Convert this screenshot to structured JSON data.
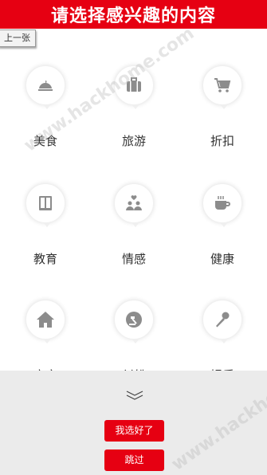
{
  "header": {
    "title": "请选择感兴趣的内容"
  },
  "prev_button": {
    "label": "上一张"
  },
  "categories": [
    {
      "label": "美食",
      "icon": "food-cloche-icon"
    },
    {
      "label": "旅游",
      "icon": "suitcase-icon"
    },
    {
      "label": "折扣",
      "icon": "shopping-cart-icon"
    },
    {
      "label": "教育",
      "icon": "book-icon"
    },
    {
      "label": "情感",
      "icon": "people-heart-icon"
    },
    {
      "label": "健康",
      "icon": "coffee-cup-icon"
    },
    {
      "label": "房产",
      "icon": "house-icon"
    },
    {
      "label": "纠纷",
      "icon": "gavel-icon"
    },
    {
      "label": "娱乐",
      "icon": "microphone-icon"
    }
  ],
  "footer": {
    "confirm_label": "我选好了",
    "skip_label": "跳过"
  },
  "watermark": {
    "text": "www.hackhome.com"
  },
  "colors": {
    "accent": "#e60012",
    "icon_gray": "#8c8c8c",
    "footer_bg": "#ebebeb"
  }
}
